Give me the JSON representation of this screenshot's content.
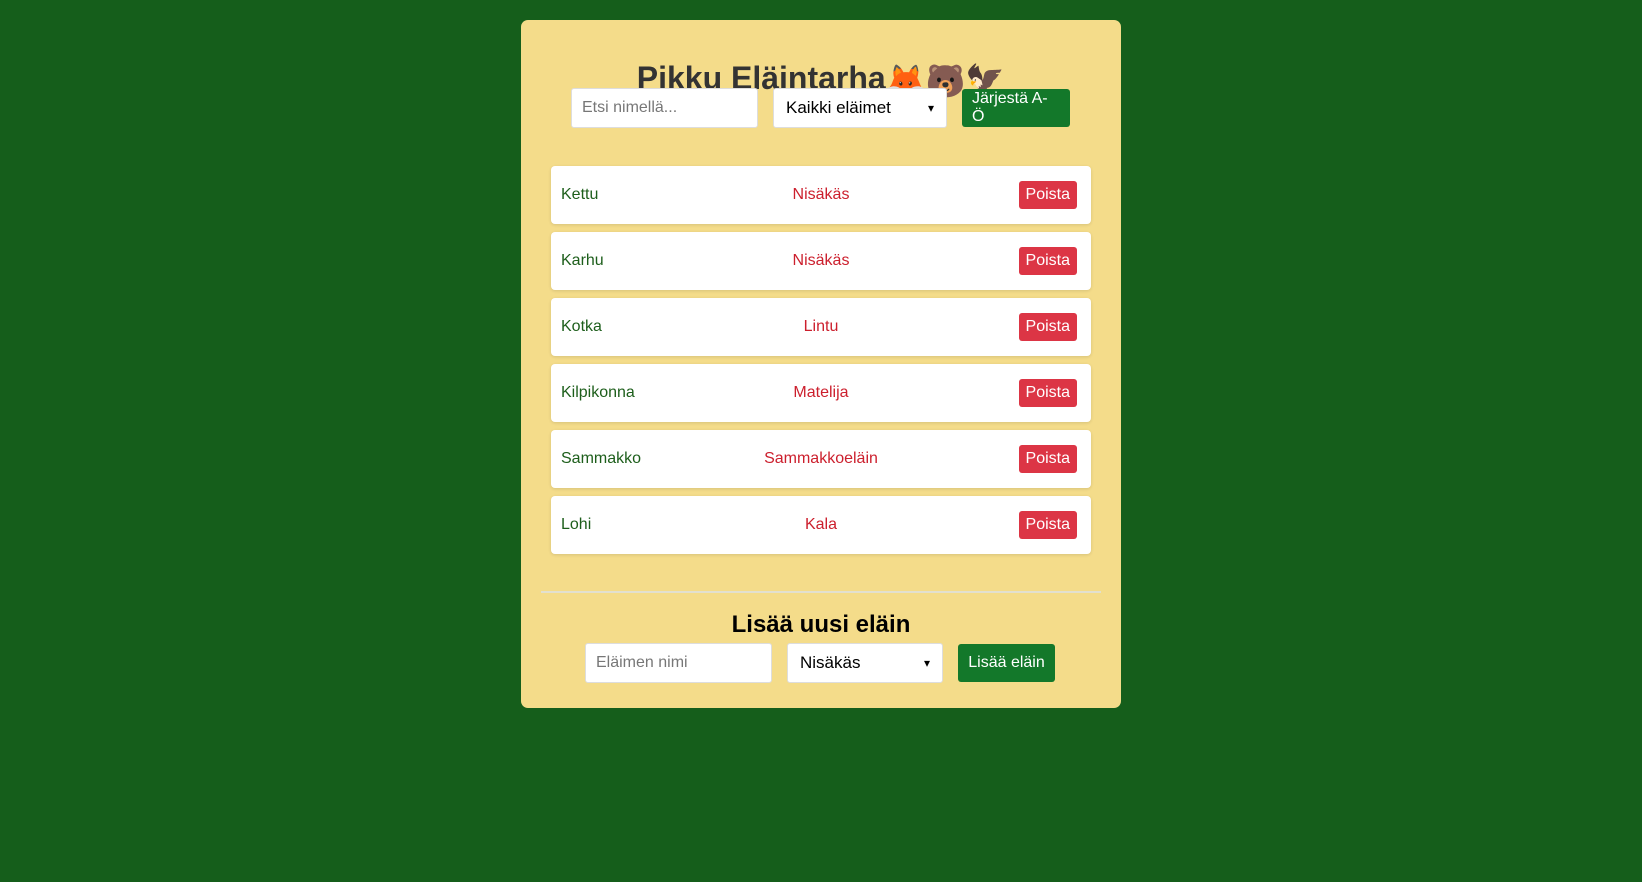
{
  "header": {
    "title": "Pikku Eläintarha",
    "emojis": "🦊🐻🦅"
  },
  "toolbar": {
    "search_placeholder": "Etsi nimellä...",
    "filter_selected": "Kaikki eläimet",
    "sort_label": "Järjestä A-Ö"
  },
  "animals": [
    {
      "name": "Kettu",
      "type": "Nisäkäs",
      "remove_label": "Poista"
    },
    {
      "name": "Karhu",
      "type": "Nisäkäs",
      "remove_label": "Poista"
    },
    {
      "name": "Kotka",
      "type": "Lintu",
      "remove_label": "Poista"
    },
    {
      "name": "Kilpikonna",
      "type": "Matelija",
      "remove_label": "Poista"
    },
    {
      "name": "Sammakko",
      "type": "Sammakkoeläin",
      "remove_label": "Poista"
    },
    {
      "name": "Lohi",
      "type": "Kala",
      "remove_label": "Poista"
    }
  ],
  "add_form": {
    "title": "Lisää uusi eläin",
    "name_placeholder": "Eläimen nimi",
    "type_selected": "Nisäkäs",
    "add_label": "Lisää eläin"
  },
  "colors": {
    "page_background": "#155e1b",
    "card_background": "#f4dc8a",
    "primary_button": "#13782a",
    "remove_button": "#dc3545",
    "name_text": "#1d5e1b",
    "type_text": "#cc1f2d"
  },
  "icons": {
    "select_chevron": "chevron-down-icon"
  }
}
